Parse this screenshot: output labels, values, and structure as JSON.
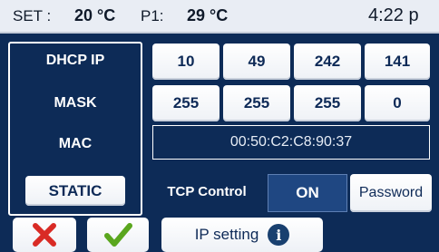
{
  "status_bar": {
    "set_label": "SET :",
    "set_value": "20 °C",
    "p1_label": "P1:",
    "p1_value": "29 °C",
    "time": "4:22 p"
  },
  "labels": {
    "dhcp_ip": "DHCP IP",
    "mask": "MASK",
    "mac": "MAC",
    "static_button": "STATIC",
    "tcp_control": "TCP Control"
  },
  "ip_octets": [
    "10",
    "49",
    "242",
    "141"
  ],
  "mask_octets": [
    "255",
    "255",
    "255",
    "0"
  ],
  "mac_address": "00:50:C2:C8:90:37",
  "tcp": {
    "on_label": "ON",
    "password_label": "Password"
  },
  "bottom": {
    "ip_setting_label": "IP setting",
    "info_glyph": "i"
  },
  "icons": {
    "cancel": "x-icon",
    "confirm": "check-icon",
    "info": "info-icon"
  },
  "colors": {
    "background": "#0d2b57",
    "key": "#ffffff",
    "cancel": "#d92b25",
    "confirm": "#5aa61e"
  }
}
